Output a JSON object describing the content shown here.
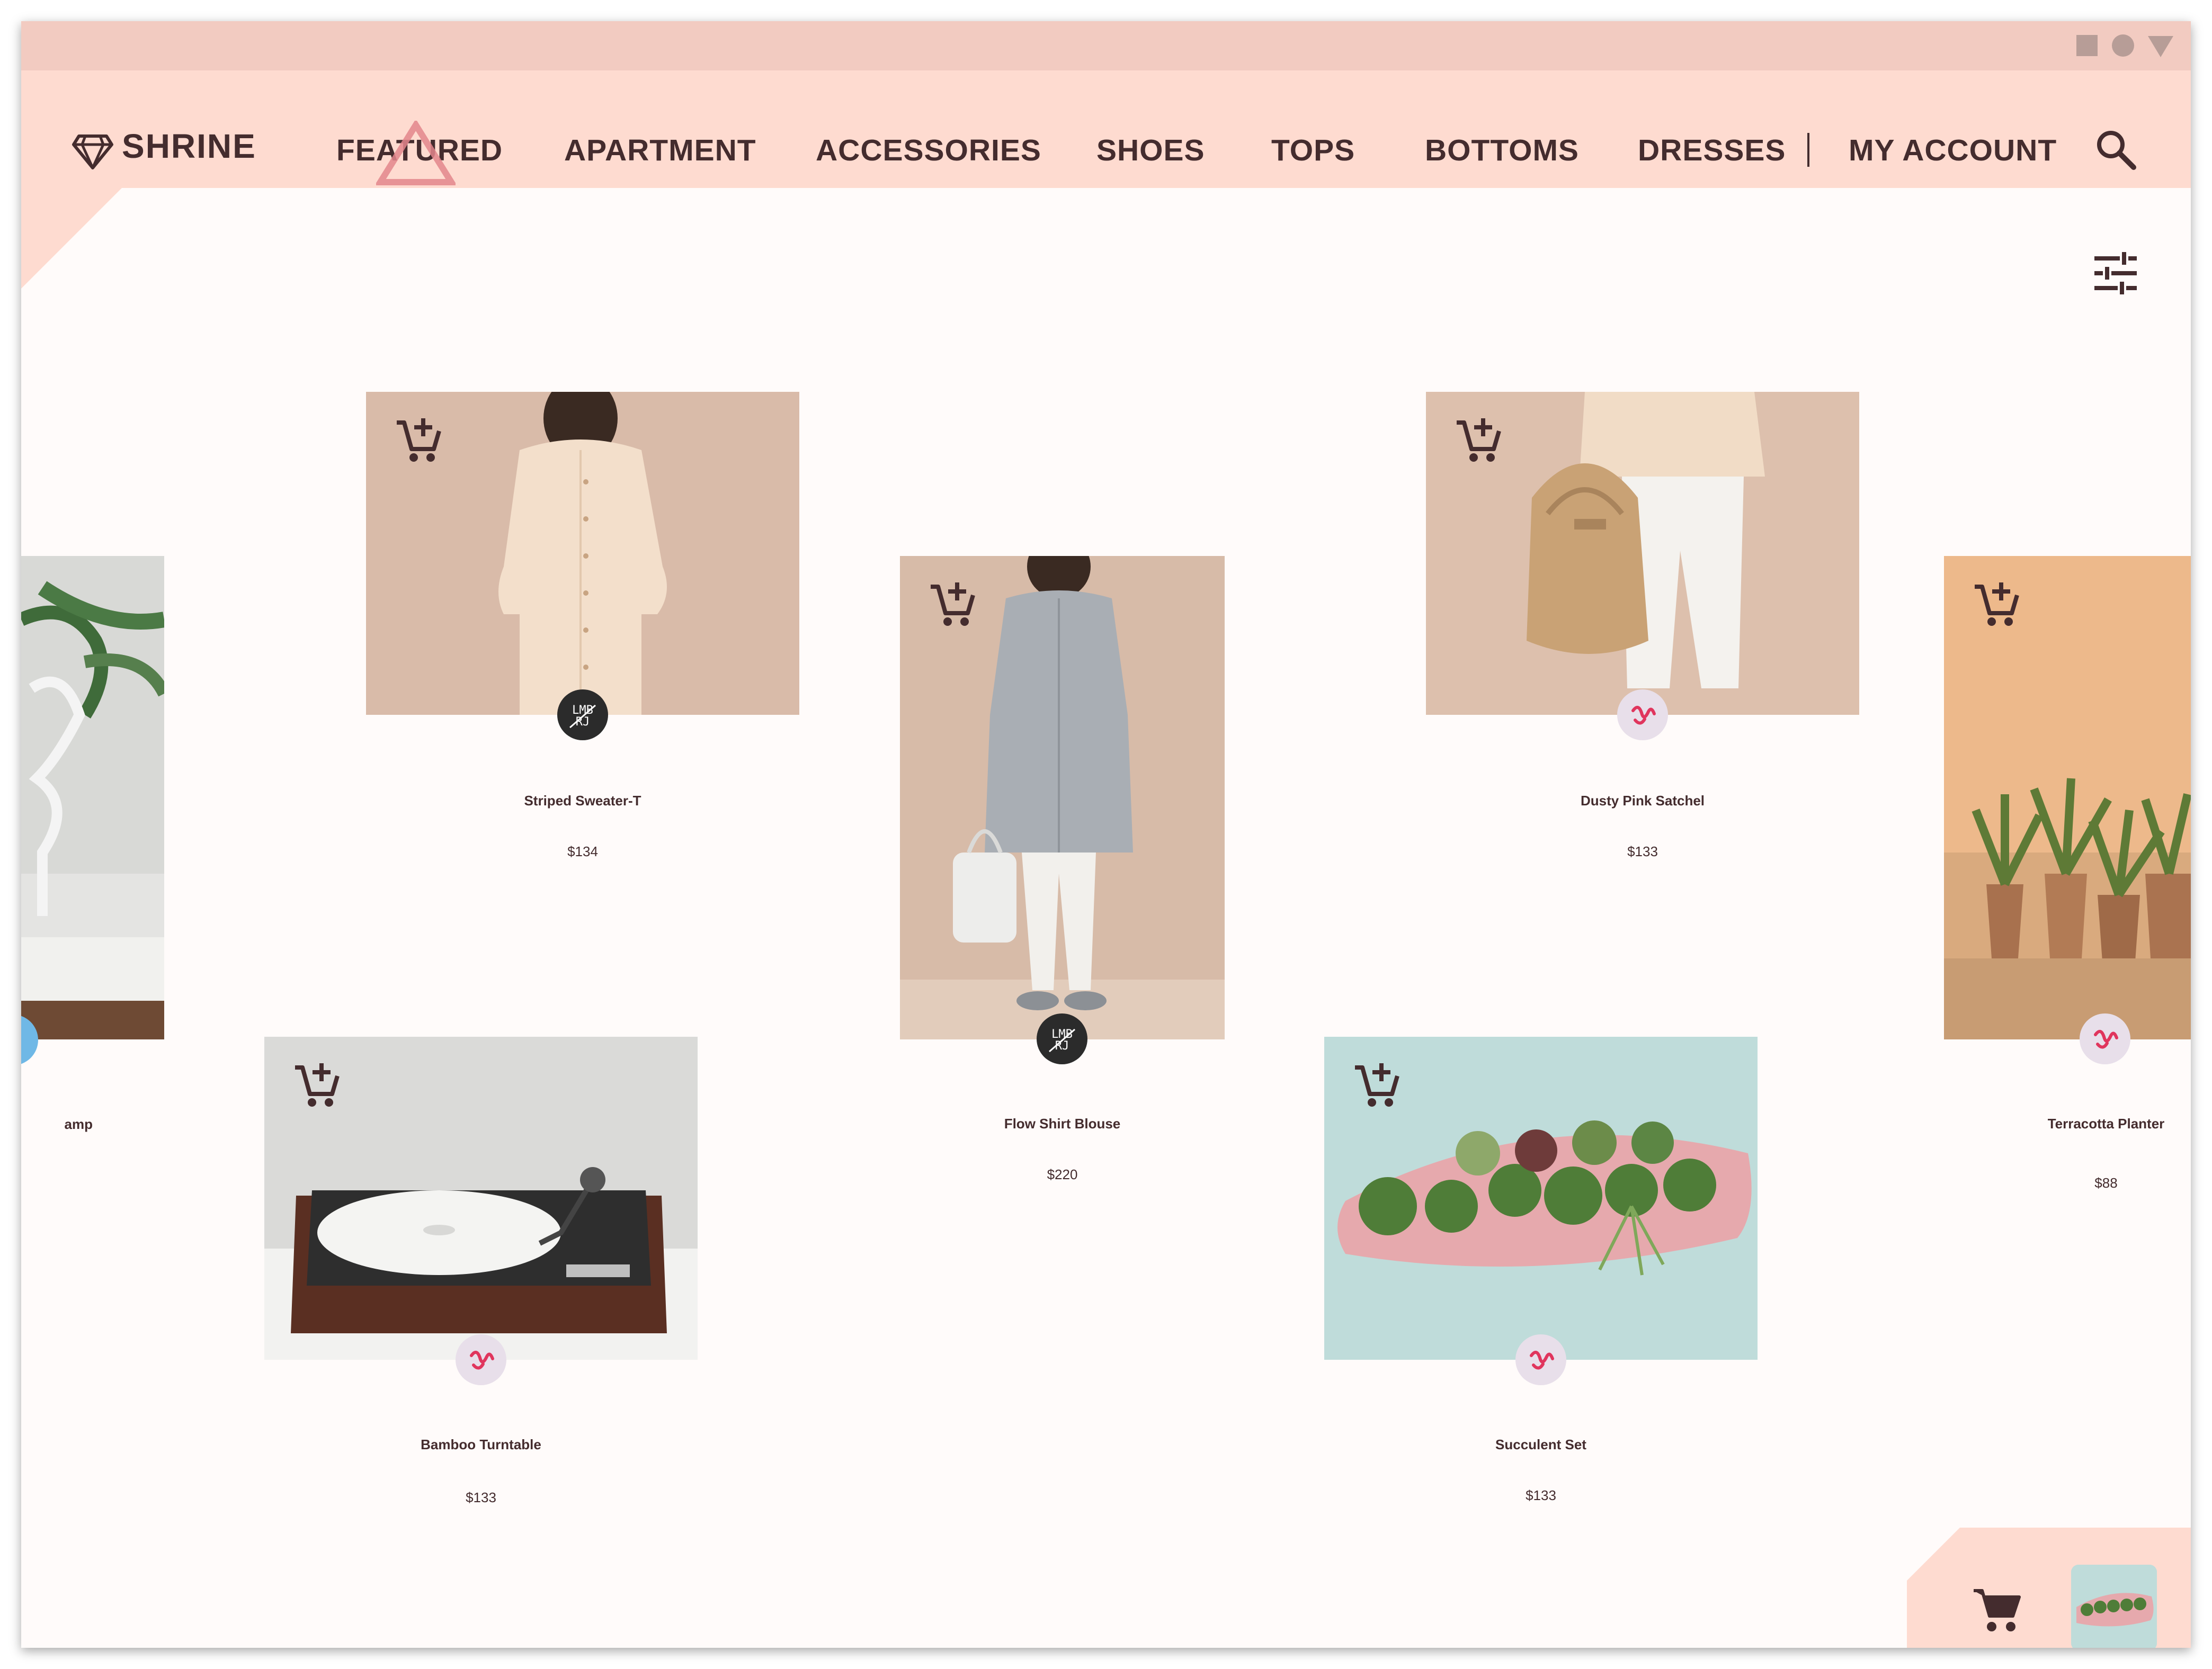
{
  "window": {
    "controls": [
      "square-control",
      "circle-control",
      "triangle-control"
    ]
  },
  "header": {
    "logo": "SHRINE",
    "nav": [
      "FEATURED",
      "APARTMENT",
      "ACCESSORIES",
      "SHOES",
      "TOPS",
      "BOTTOMS",
      "DRESSES"
    ],
    "account": "MY ACCOUNT",
    "active_nav": "FEATURED",
    "icons": [
      "diamond-logo-icon",
      "search-icon"
    ]
  },
  "filter": {
    "icon": "tune-icon"
  },
  "products": [
    {
      "name": "amp",
      "price": "",
      "vendor": "blue",
      "partial": "left"
    },
    {
      "name": "Striped Sweater-T",
      "price": "$134",
      "vendor": "dark"
    },
    {
      "name": "Flow Shirt Blouse",
      "price": "$220",
      "vendor": "dark"
    },
    {
      "name": "Dusty Pink Satchel",
      "price": "$133",
      "vendor": "light"
    },
    {
      "name": "Terracotta Planter",
      "price": "$88",
      "vendor": "light",
      "partial": "right"
    },
    {
      "name": "Bamboo Turntable",
      "price": "$133",
      "vendor": "light"
    },
    {
      "name": "Succulent Set",
      "price": "$133",
      "vendor": "light"
    }
  ],
  "cart": {
    "icon": "shopping-cart-icon",
    "item_count": 1
  },
  "colors": {
    "header": "#FEDBD0",
    "chrome": "#F2CBC1",
    "background": "#FFFBFA",
    "text": "#442C2E"
  }
}
